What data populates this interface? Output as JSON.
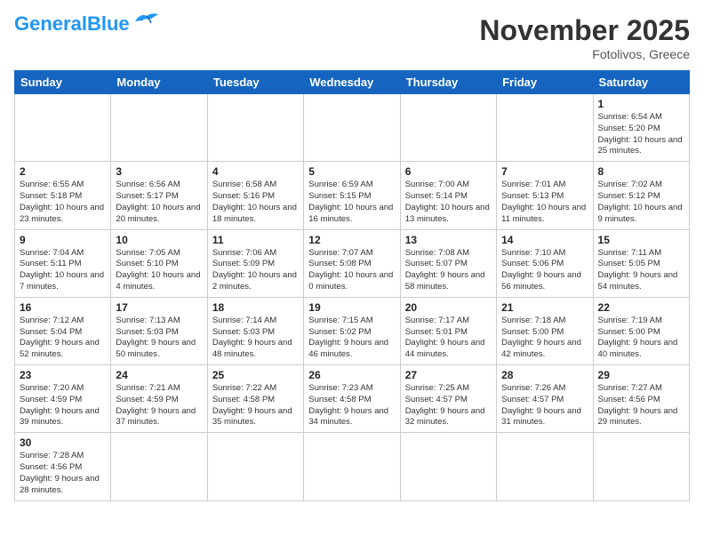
{
  "header": {
    "logo_general": "General",
    "logo_blue": "Blue",
    "month_title": "November 2025",
    "location": "Fotolivos, Greece"
  },
  "days_of_week": [
    "Sunday",
    "Monday",
    "Tuesday",
    "Wednesday",
    "Thursday",
    "Friday",
    "Saturday"
  ],
  "weeks": [
    [
      {
        "day": "",
        "info": ""
      },
      {
        "day": "",
        "info": ""
      },
      {
        "day": "",
        "info": ""
      },
      {
        "day": "",
        "info": ""
      },
      {
        "day": "",
        "info": ""
      },
      {
        "day": "",
        "info": ""
      },
      {
        "day": "1",
        "info": "Sunrise: 6:54 AM\nSunset: 5:20 PM\nDaylight: 10 hours\nand 25 minutes."
      }
    ],
    [
      {
        "day": "2",
        "info": "Sunrise: 6:55 AM\nSunset: 5:18 PM\nDaylight: 10 hours\nand 23 minutes."
      },
      {
        "day": "3",
        "info": "Sunrise: 6:56 AM\nSunset: 5:17 PM\nDaylight: 10 hours\nand 20 minutes."
      },
      {
        "day": "4",
        "info": "Sunrise: 6:58 AM\nSunset: 5:16 PM\nDaylight: 10 hours\nand 18 minutes."
      },
      {
        "day": "5",
        "info": "Sunrise: 6:59 AM\nSunset: 5:15 PM\nDaylight: 10 hours\nand 16 minutes."
      },
      {
        "day": "6",
        "info": "Sunrise: 7:00 AM\nSunset: 5:14 PM\nDaylight: 10 hours\nand 13 minutes."
      },
      {
        "day": "7",
        "info": "Sunrise: 7:01 AM\nSunset: 5:13 PM\nDaylight: 10 hours\nand 11 minutes."
      },
      {
        "day": "8",
        "info": "Sunrise: 7:02 AM\nSunset: 5:12 PM\nDaylight: 10 hours\nand 9 minutes."
      }
    ],
    [
      {
        "day": "9",
        "info": "Sunrise: 7:04 AM\nSunset: 5:11 PM\nDaylight: 10 hours\nand 7 minutes."
      },
      {
        "day": "10",
        "info": "Sunrise: 7:05 AM\nSunset: 5:10 PM\nDaylight: 10 hours\nand 4 minutes."
      },
      {
        "day": "11",
        "info": "Sunrise: 7:06 AM\nSunset: 5:09 PM\nDaylight: 10 hours\nand 2 minutes."
      },
      {
        "day": "12",
        "info": "Sunrise: 7:07 AM\nSunset: 5:08 PM\nDaylight: 10 hours\nand 0 minutes."
      },
      {
        "day": "13",
        "info": "Sunrise: 7:08 AM\nSunset: 5:07 PM\nDaylight: 9 hours\nand 58 minutes."
      },
      {
        "day": "14",
        "info": "Sunrise: 7:10 AM\nSunset: 5:06 PM\nDaylight: 9 hours\nand 56 minutes."
      },
      {
        "day": "15",
        "info": "Sunrise: 7:11 AM\nSunset: 5:05 PM\nDaylight: 9 hours\nand 54 minutes."
      }
    ],
    [
      {
        "day": "16",
        "info": "Sunrise: 7:12 AM\nSunset: 5:04 PM\nDaylight: 9 hours\nand 52 minutes."
      },
      {
        "day": "17",
        "info": "Sunrise: 7:13 AM\nSunset: 5:03 PM\nDaylight: 9 hours\nand 50 minutes."
      },
      {
        "day": "18",
        "info": "Sunrise: 7:14 AM\nSunset: 5:03 PM\nDaylight: 9 hours\nand 48 minutes."
      },
      {
        "day": "19",
        "info": "Sunrise: 7:15 AM\nSunset: 5:02 PM\nDaylight: 9 hours\nand 46 minutes."
      },
      {
        "day": "20",
        "info": "Sunrise: 7:17 AM\nSunset: 5:01 PM\nDaylight: 9 hours\nand 44 minutes."
      },
      {
        "day": "21",
        "info": "Sunrise: 7:18 AM\nSunset: 5:00 PM\nDaylight: 9 hours\nand 42 minutes."
      },
      {
        "day": "22",
        "info": "Sunrise: 7:19 AM\nSunset: 5:00 PM\nDaylight: 9 hours\nand 40 minutes."
      }
    ],
    [
      {
        "day": "23",
        "info": "Sunrise: 7:20 AM\nSunset: 4:59 PM\nDaylight: 9 hours\nand 39 minutes."
      },
      {
        "day": "24",
        "info": "Sunrise: 7:21 AM\nSunset: 4:59 PM\nDaylight: 9 hours\nand 37 minutes."
      },
      {
        "day": "25",
        "info": "Sunrise: 7:22 AM\nSunset: 4:58 PM\nDaylight: 9 hours\nand 35 minutes."
      },
      {
        "day": "26",
        "info": "Sunrise: 7:23 AM\nSunset: 4:58 PM\nDaylight: 9 hours\nand 34 minutes."
      },
      {
        "day": "27",
        "info": "Sunrise: 7:25 AM\nSunset: 4:57 PM\nDaylight: 9 hours\nand 32 minutes."
      },
      {
        "day": "28",
        "info": "Sunrise: 7:26 AM\nSunset: 4:57 PM\nDaylight: 9 hours\nand 31 minutes."
      },
      {
        "day": "29",
        "info": "Sunrise: 7:27 AM\nSunset: 4:56 PM\nDaylight: 9 hours\nand 29 minutes."
      }
    ],
    [
      {
        "day": "30",
        "info": "Sunrise: 7:28 AM\nSunset: 4:56 PM\nDaylight: 9 hours\nand 28 minutes."
      },
      {
        "day": "",
        "info": ""
      },
      {
        "day": "",
        "info": ""
      },
      {
        "day": "",
        "info": ""
      },
      {
        "day": "",
        "info": ""
      },
      {
        "day": "",
        "info": ""
      },
      {
        "day": "",
        "info": ""
      }
    ]
  ]
}
